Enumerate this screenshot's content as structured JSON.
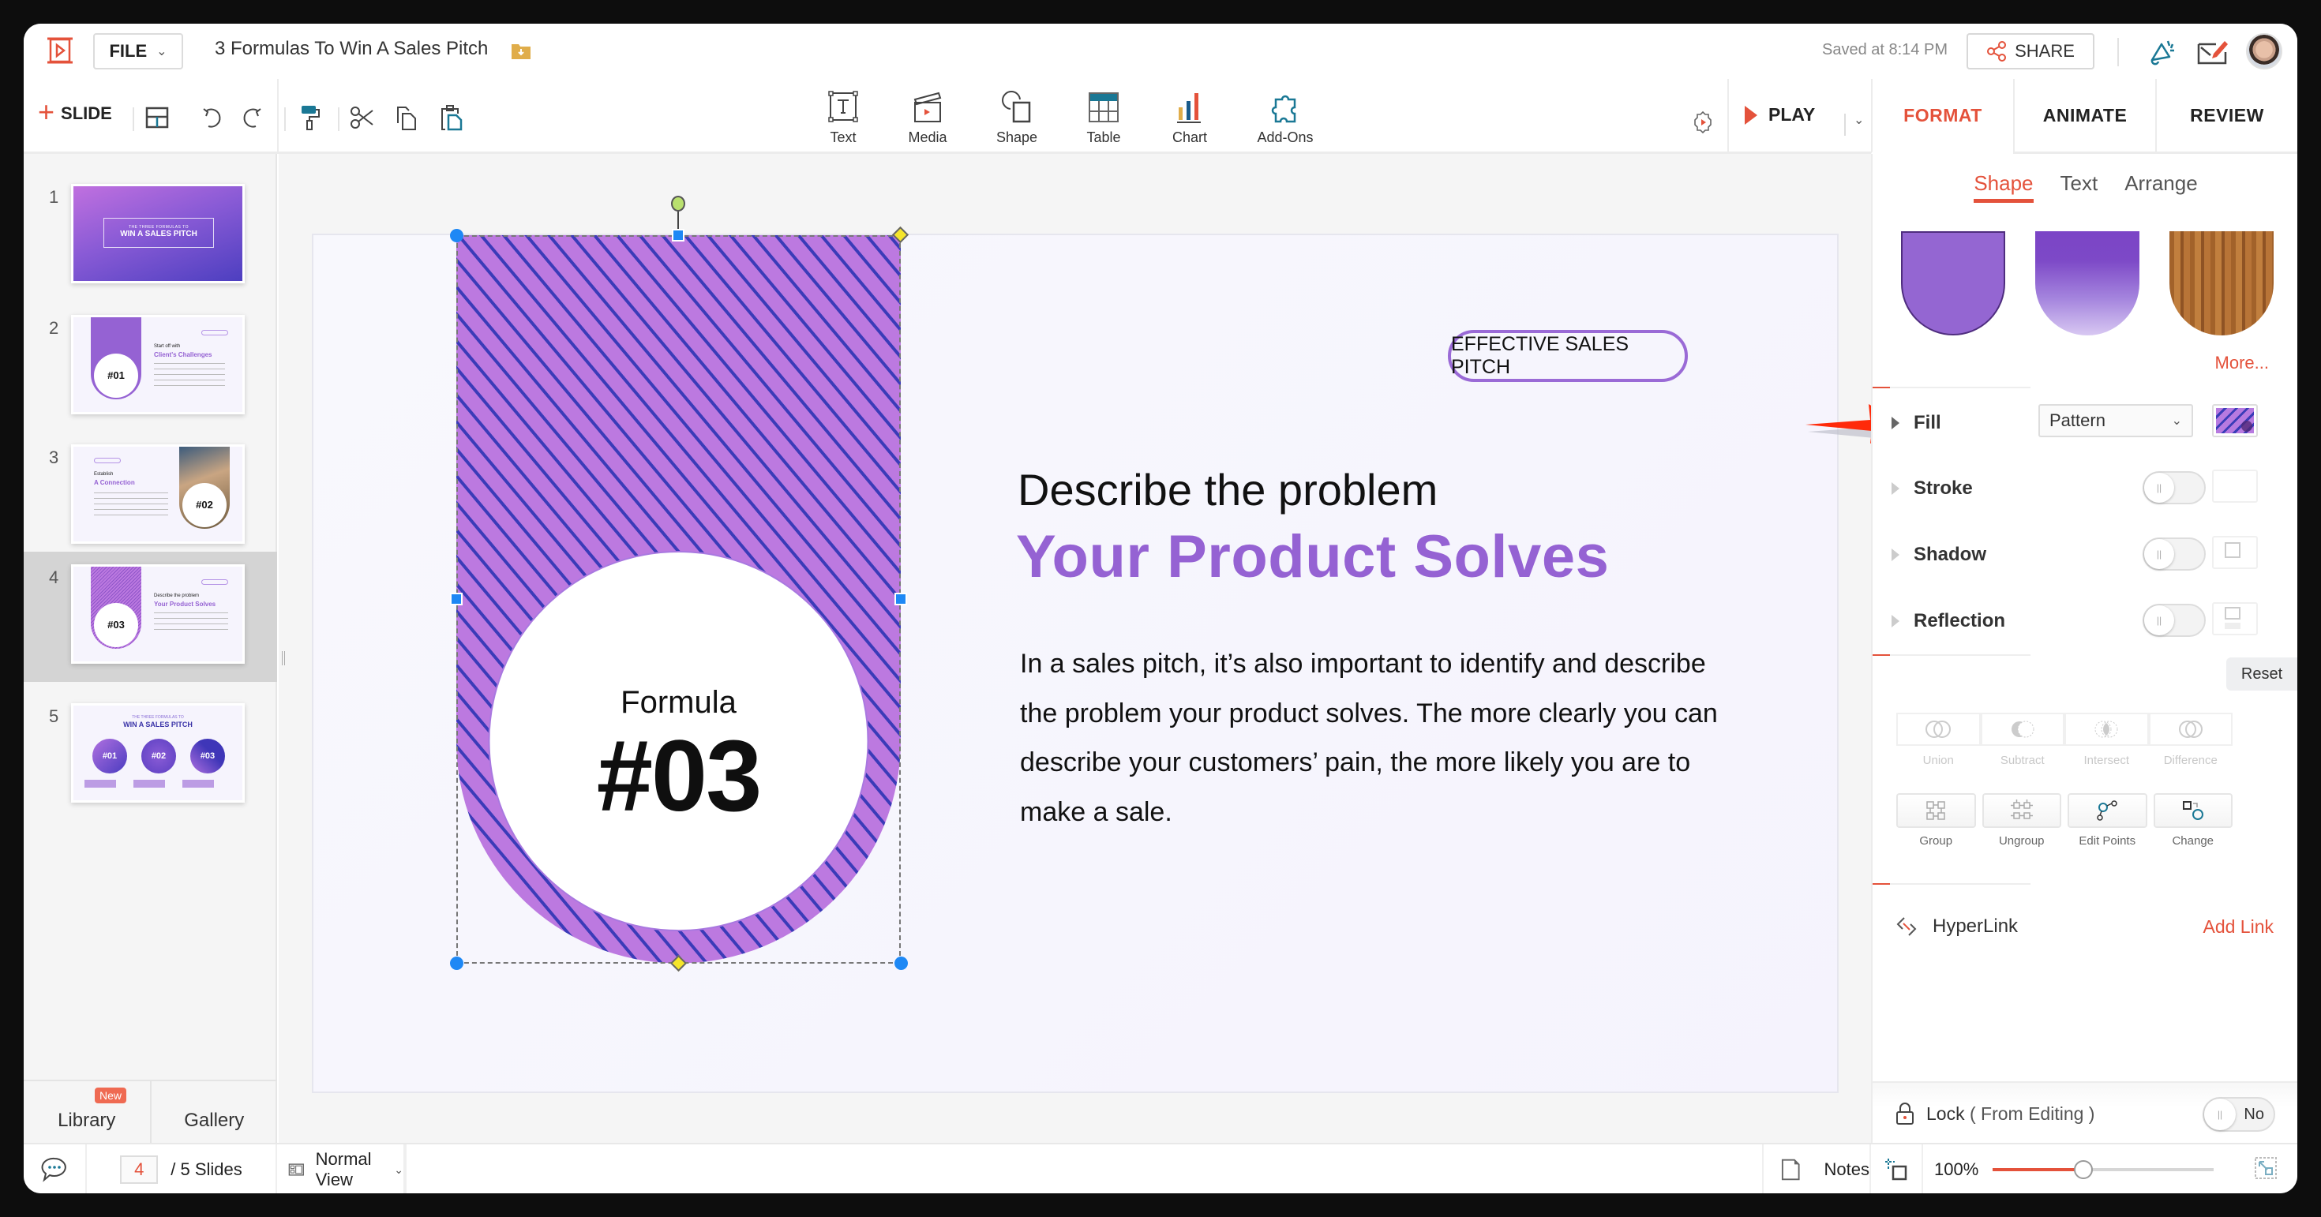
{
  "header": {
    "app_icon": "presentation-play-icon",
    "file_menu": "FILE",
    "document_title": "3 Formulas To Win A Sales Pitch",
    "saved_status": "Saved at 8:14 PM",
    "share_label": "SHARE"
  },
  "toolbar": {
    "add_slide_label": "SLIDE",
    "insert_items": [
      {
        "label": "Text",
        "icon": "text-box-icon"
      },
      {
        "label": "Media",
        "icon": "media-clapper-icon"
      },
      {
        "label": "Shape",
        "icon": "shape-icon"
      },
      {
        "label": "Table",
        "icon": "table-icon"
      },
      {
        "label": "Chart",
        "icon": "chart-icon"
      },
      {
        "label": "Add-Ons",
        "icon": "puzzle-icon"
      }
    ],
    "play_label": "PLAY"
  },
  "panel_tabs": [
    {
      "label": "FORMAT",
      "active": true
    },
    {
      "label": "ANIMATE",
      "active": false
    },
    {
      "label": "REVIEW",
      "active": false
    }
  ],
  "slides": [
    {
      "number": "1",
      "kicker": "THE THREE FORMULAS TO",
      "title": "WIN A SALES PITCH"
    },
    {
      "number": "2",
      "formula": "#01",
      "sub": "Start off with",
      "title": "Client's Challenges"
    },
    {
      "number": "3",
      "formula": "#02",
      "sub": "Establish",
      "title": "A Connection"
    },
    {
      "number": "4",
      "formula": "#03",
      "sub": "Describe the problem",
      "title": "Your Product Solves",
      "active": true
    },
    {
      "number": "5",
      "kicker": "THE THREE FORMULAS TO",
      "title": "WIN A SALES PITCH",
      "items": [
        "#01",
        "#02",
        "#03"
      ]
    }
  ],
  "left_bottom": {
    "library_label": "Library",
    "new_badge": "New",
    "gallery_label": "Gallery"
  },
  "slide": {
    "pill_label": "EFFECTIVE SALES PITCH",
    "subheading": "Describe the problem",
    "heading": "Your Product Solves",
    "body": "In a sales pitch, it’s also important to identify and describe the problem your product solves. The more clearly you can describe your customers’ pain, the more likely you are to make a sale.",
    "formula_label": "Formula",
    "formula_number": "#03",
    "accent_color": "#9562d3",
    "pattern_colors": [
      "#bc79e0",
      "#3b3bb8"
    ]
  },
  "format_panel": {
    "subtabs": [
      {
        "label": "Shape",
        "active": true
      },
      {
        "label": "Text",
        "active": false
      },
      {
        "label": "Arrange",
        "active": false
      }
    ],
    "presets_more": "More...",
    "fill": {
      "label": "Fill",
      "value": "Pattern"
    },
    "stroke": {
      "label": "Stroke",
      "enabled": false
    },
    "shadow": {
      "label": "Shadow",
      "enabled": false
    },
    "reflection": {
      "label": "Reflection",
      "enabled": false
    },
    "reset_label": "Reset",
    "boolean_ops": [
      "Union",
      "Subtract",
      "Intersect",
      "Difference"
    ],
    "group_ops": [
      "Group",
      "Ungroup",
      "Edit Points",
      "Change"
    ],
    "hyperlink_label": "HyperLink",
    "add_link_label": "Add Link",
    "lock_label": "Lock",
    "lock_sub": "( From Editing )",
    "lock_value": "No"
  },
  "status_bar": {
    "current_page": "4",
    "total_pages": "/ 5 Slides",
    "view_mode": "Normal View",
    "notes_label": "Notes",
    "zoom": "100%",
    "zoom_fraction": 0.41
  }
}
